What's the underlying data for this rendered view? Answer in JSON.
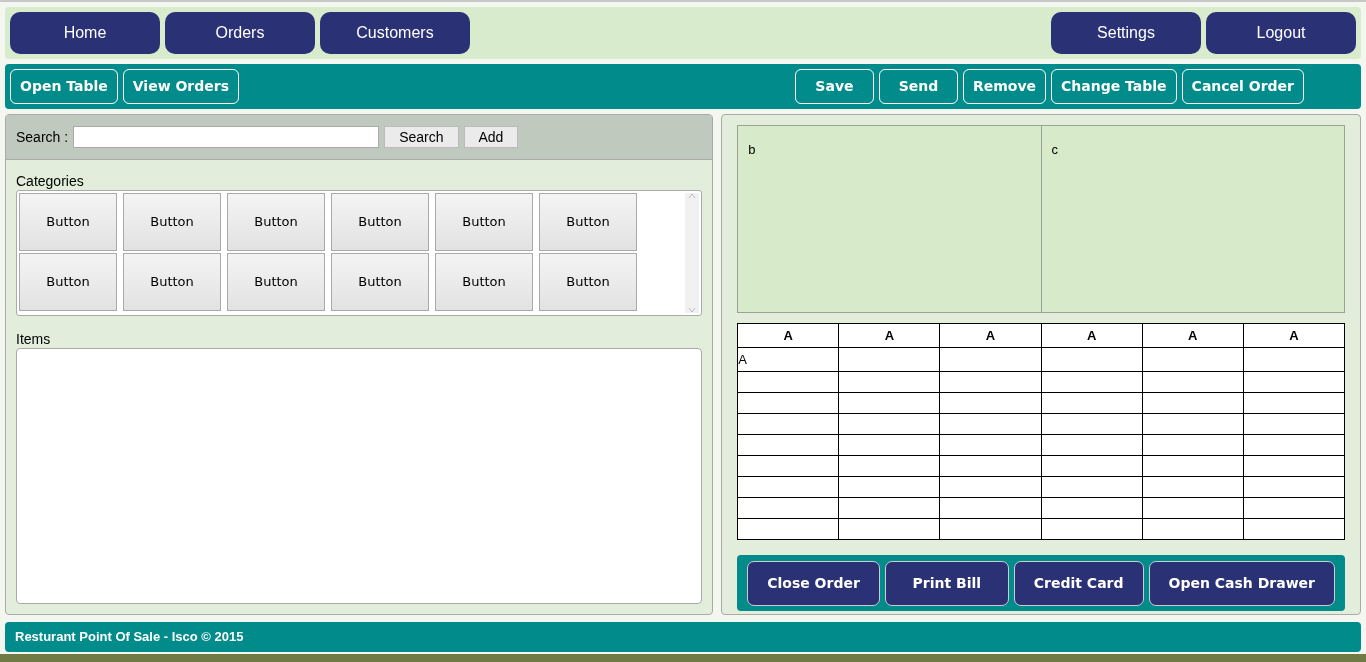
{
  "nav": {
    "left": [
      "Home",
      "Orders",
      "Customers"
    ],
    "right": [
      "Settings",
      "Logout"
    ]
  },
  "toolbar": {
    "left": [
      "Open Table",
      "View Orders"
    ],
    "right": [
      "Save",
      "Send",
      "Remove",
      "Change Table",
      "Cancel Order"
    ]
  },
  "search": {
    "label": "Search :",
    "buttons": [
      "Search",
      "Add"
    ]
  },
  "categories": {
    "label": "Categories",
    "buttons": [
      "Button",
      "Button",
      "Button",
      "Button",
      "Button",
      "Button",
      "Button",
      "Button",
      "Button",
      "Button",
      "Button",
      "Button"
    ]
  },
  "items": {
    "label": "Items"
  },
  "panels": [
    "b",
    "c"
  ],
  "table": {
    "columns": [
      "A",
      "A",
      "A",
      "A",
      "A",
      "A"
    ],
    "rows": [
      [
        "A",
        "",
        "",
        "",
        "",
        ""
      ],
      [
        "",
        "",
        "",
        "",
        "",
        ""
      ],
      [
        "",
        "",
        "",
        "",
        "",
        ""
      ],
      [
        "",
        "",
        "",
        "",
        "",
        ""
      ],
      [
        "",
        "",
        "",
        "",
        "",
        ""
      ],
      [
        "",
        "",
        "",
        "",
        "",
        ""
      ],
      [
        "",
        "",
        "",
        "",
        "",
        ""
      ],
      [
        "",
        "",
        "",
        "",
        "",
        ""
      ],
      [
        "",
        "",
        "",
        "",
        "",
        ""
      ]
    ]
  },
  "actions": [
    "Close Order",
    "Print Bill",
    "Credit Card",
    "Open Cash Drawer"
  ],
  "footer": "Resturant Point Of Sale - Isco © 2015"
}
